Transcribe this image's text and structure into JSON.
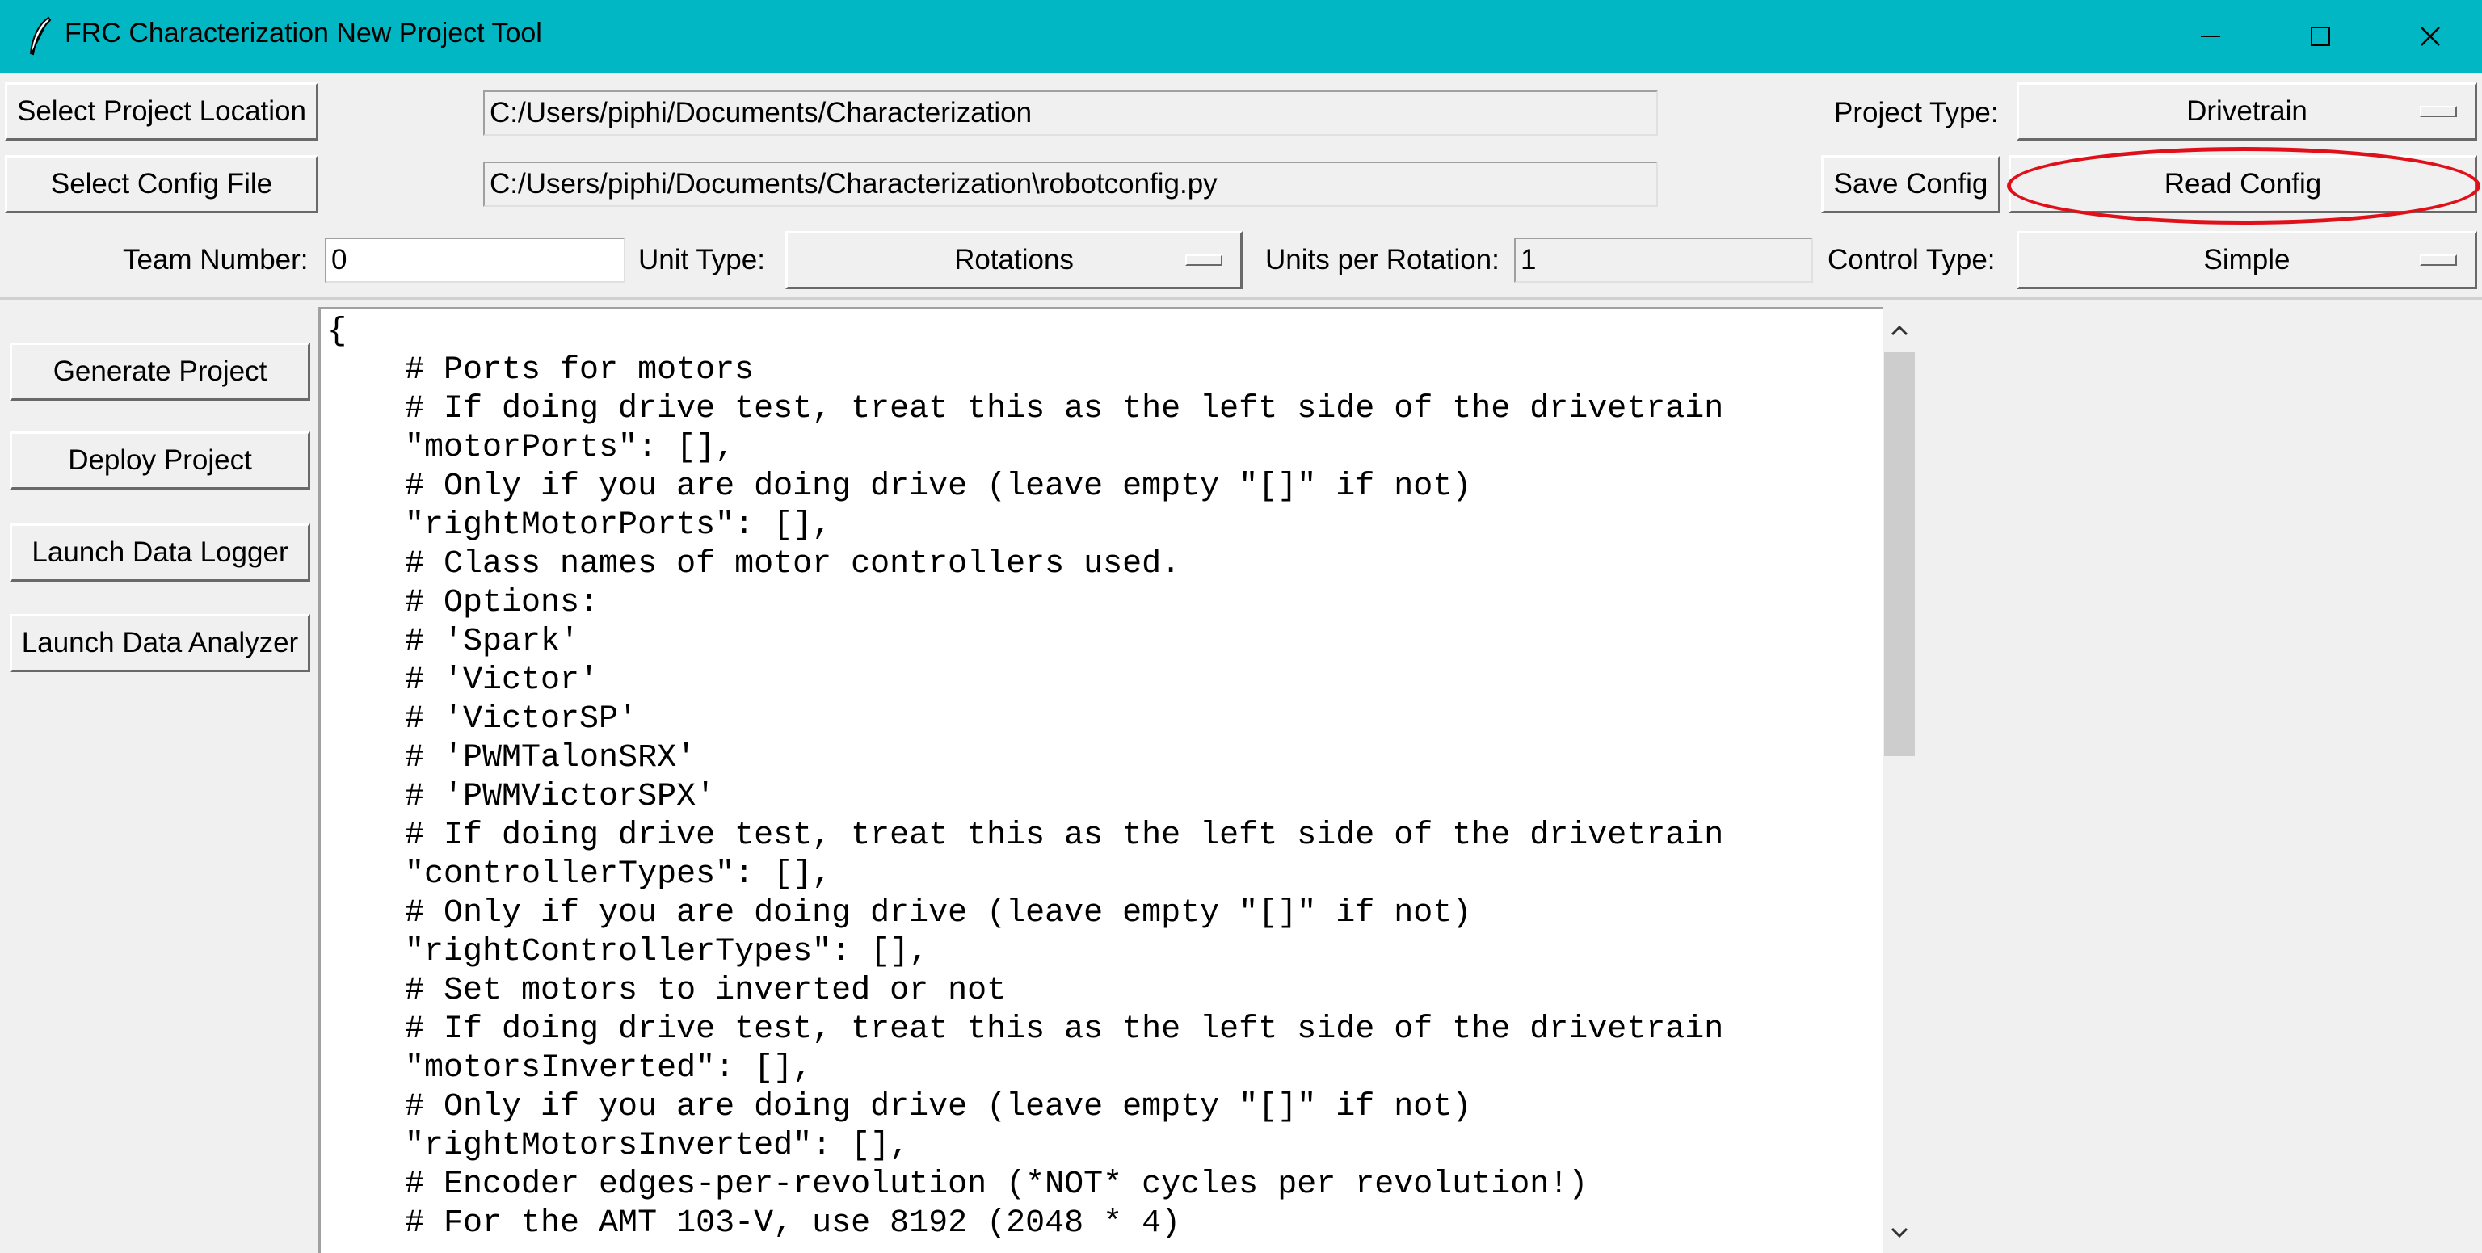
{
  "window": {
    "title": "FRC Characterization New Project Tool"
  },
  "buttons": {
    "select_project_location": "Select Project Location",
    "select_config_file": "Select Config File",
    "save_config": "Save Config",
    "read_config": "Read Config",
    "generate_project": "Generate Project",
    "deploy_project": "Deploy Project",
    "launch_data_logger": "Launch Data Logger",
    "launch_data_analyzer": "Launch Data Analyzer"
  },
  "fields": {
    "project_location": "C:/Users/piphi/Documents/Characterization",
    "config_file": "C:/Users/piphi/Documents/Characterization\\robotconfig.py",
    "team_number": "0",
    "units_per_rotation": "1"
  },
  "labels": {
    "project_type": "Project Type:",
    "team_number": "Team Number:",
    "unit_type": "Unit Type:",
    "units_per_rotation": "Units per Rotation:",
    "control_type": "Control Type:"
  },
  "dropdowns": {
    "project_type": "Drivetrain",
    "unit_type": "Rotations",
    "control_type": "Simple"
  },
  "editor": {
    "content": "{\n    # Ports for motors\n    # If doing drive test, treat this as the left side of the drivetrain\n    \"motorPorts\": [],\n    # Only if you are doing drive (leave empty \"[]\" if not)\n    \"rightMotorPorts\": [],\n    # Class names of motor controllers used.\n    # Options:\n    # 'Spark'\n    # 'Victor'\n    # 'VictorSP'\n    # 'PWMTalonSRX'\n    # 'PWMVictorSPX'\n    # If doing drive test, treat this as the left side of the drivetrain\n    \"controllerTypes\": [],\n    # Only if you are doing drive (leave empty \"[]\" if not)\n    \"rightControllerTypes\": [],\n    # Set motors to inverted or not\n    # If doing drive test, treat this as the left side of the drivetrain\n    \"motorsInverted\": [],\n    # Only if you are doing drive (leave empty \"[]\" if not)\n    \"rightMotorsInverted\": [],\n    # Encoder edges-per-revolution (*NOT* cycles per revolution!)\n    # For the AMT 103-V, use 8192 (2048 * 4)"
  },
  "colors": {
    "titlebar": "#00b7c3",
    "highlight": "#e0101b"
  },
  "icons": {
    "app": "feather-icon",
    "minimize": "minimize-icon",
    "maximize": "maximize-icon",
    "close": "close-icon",
    "scroll_up": "chevron-up-icon",
    "scroll_down": "chevron-down-icon"
  }
}
